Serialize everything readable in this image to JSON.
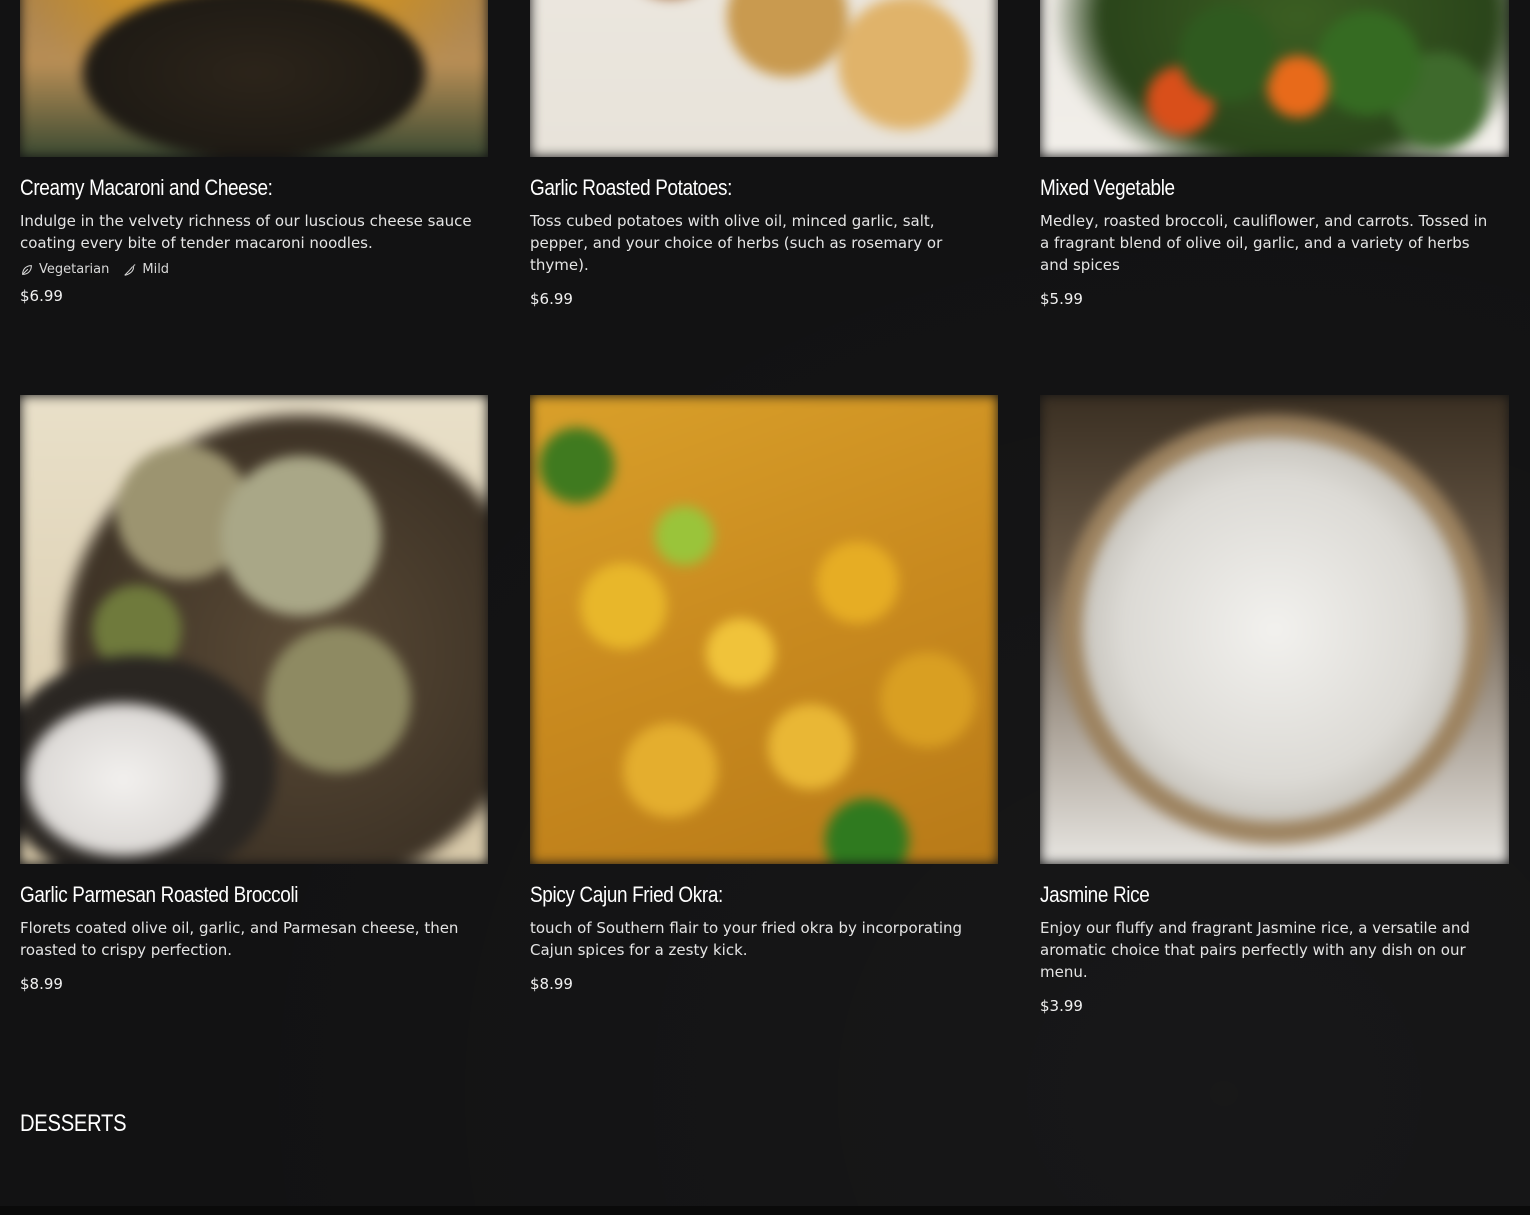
{
  "sides": {
    "row1": [
      {
        "name": "Creamy Macaroni and Cheese:",
        "description": "Indulge in the velvety richness of our luscious cheese sauce coating every bite of tender macaroni noodles.",
        "tags": [
          "Vegetarian",
          "Mild"
        ],
        "price": "$6.99"
      },
      {
        "name": "Garlic Roasted Potatoes:",
        "description": "Toss cubed potatoes with olive oil, minced garlic, salt, pepper, and your choice of herbs (such as rosemary or thyme).",
        "price": "$6.99"
      },
      {
        "name": "Mixed Vegetable",
        "description": "Medley, roasted broccoli, cauliflower, and carrots. Tossed in a fragrant blend of olive oil, garlic, and a variety of herbs and spices",
        "price": "$5.99"
      }
    ],
    "row2": [
      {
        "name": "Garlic Parmesan Roasted Broccoli",
        "description": "Florets coated olive oil, garlic, and Parmesan cheese, then roasted to crispy perfection.",
        "price": "$8.99"
      },
      {
        "name": "Spicy Cajun Fried Okra:",
        "description": "touch of Southern flair to your fried okra by incorporating Cajun spices for a zesty kick.",
        "price": "$8.99"
      },
      {
        "name": "Jasmine Rice",
        "description": "Enjoy our fluffy and fragrant Jasmine rice, a versatile and aromatic choice that pairs perfectly with any dish on our menu.",
        "price": "$3.99"
      }
    ]
  },
  "next_section": {
    "title": "DESSERTS"
  },
  "icons": {
    "vegetarian": "leaf-icon",
    "mild": "chili-pepper-icon"
  }
}
